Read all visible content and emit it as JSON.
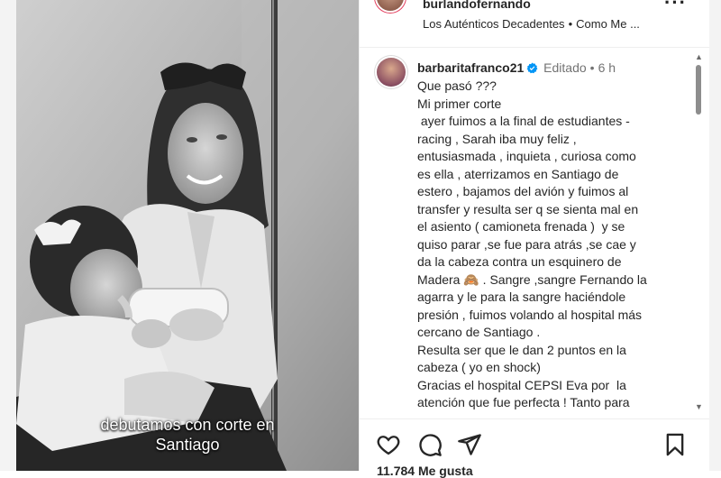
{
  "post": {
    "caption_lines": [
      "debutamos con corte en",
      "Santiago"
    ]
  },
  "header": {
    "username": "burlandofernando",
    "music_artist": "Los Auténticos Decadentes",
    "music_separator": "•",
    "music_title": "Como Me ..."
  },
  "comment": {
    "username": "barbaritafranco21",
    "edited": "Editado",
    "dot": "•",
    "time": "6 h",
    "lines": [
      "Que pasó ???",
      "Mi primer corte",
      " ayer fuimos a la final de estudiantes -",
      "racing , Sarah iba muy feliz ,",
      "entusiasmada , inquieta , curiosa como",
      "es ella , aterrizamos en Santiago de",
      "estero , bajamos del avión y fuimos al",
      "transfer y resulta ser q se sienta mal en",
      "el asiento ( camioneta frenada )  y se",
      "quiso parar ,se fue para atrás ,se cae y",
      "da la cabeza contra un esquinero de",
      "Madera 🙈 . Sangre ,sangre Fernando la",
      "agarra y le para la sangre haciéndole",
      "presión , fuimos volando al hospital más",
      "cercano de Santiago .",
      "Resulta ser que le dan 2 puntos en la",
      "cabeza ( yo en shock)",
      "Gracias el hospital CEPSI Eva por  la",
      "atención que fue perfecta ! Tanto para"
    ]
  },
  "footer": {
    "likes": "11.784 Me gusta"
  },
  "colors": {
    "verified": "#0095f6",
    "text": "#262626",
    "muted": "#737373"
  }
}
